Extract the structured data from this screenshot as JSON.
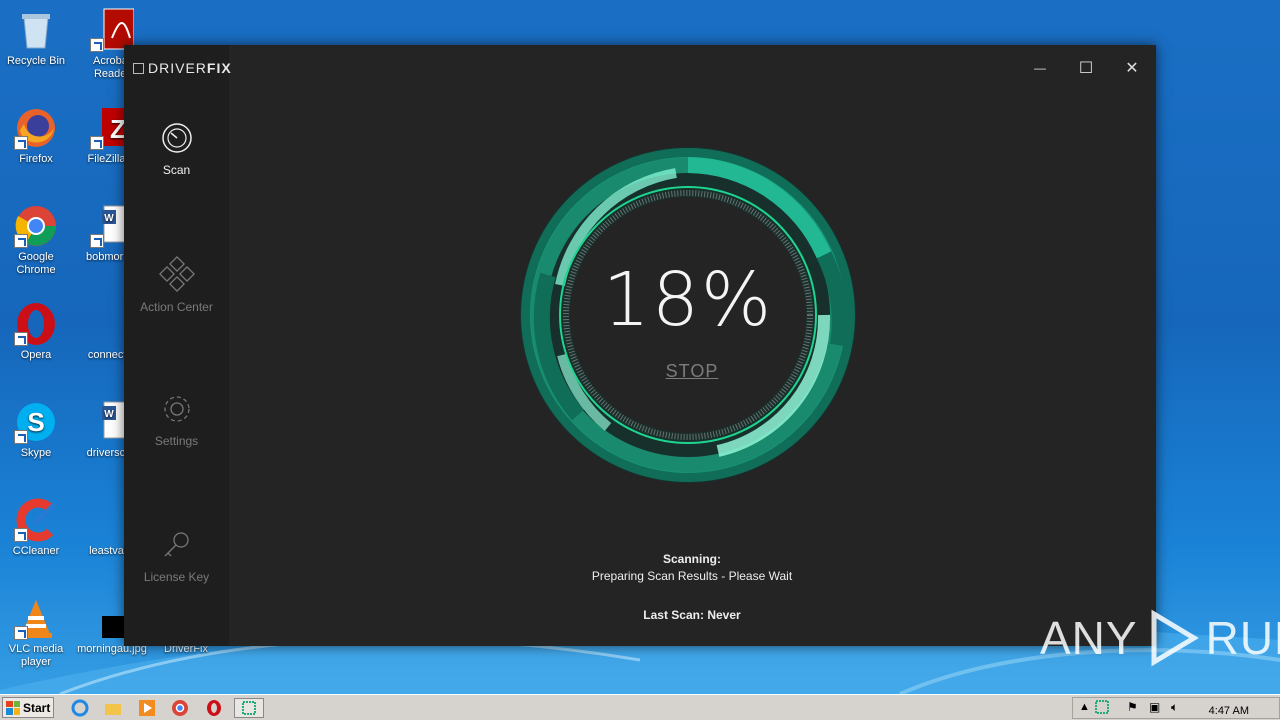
{
  "desktop": {
    "icons": [
      {
        "label": "Recycle Bin"
      },
      {
        "label": "Acrobat\nReader"
      },
      {
        "label": "Firefox"
      },
      {
        "label": "FileZilla C"
      },
      {
        "label": "Google\nChrome"
      },
      {
        "label": "bobmornin"
      },
      {
        "label": "Opera"
      },
      {
        "label": "connectar"
      },
      {
        "label": "Skype"
      },
      {
        "label": "driverscho"
      },
      {
        "label": "CCleaner"
      },
      {
        "label": "leastvalid"
      },
      {
        "label": "VLC media\nplayer"
      },
      {
        "label": "morningau.jpg"
      },
      {
        "label": "DriverFix"
      }
    ]
  },
  "app": {
    "brand_light": "DRIVER",
    "brand_bold": "FIX",
    "nav": [
      {
        "label": "Scan",
        "icon": "gauge-icon",
        "active": true
      },
      {
        "label": "Action Center",
        "icon": "diamond-grid-icon",
        "active": false
      },
      {
        "label": "Settings",
        "icon": "gear-icon",
        "active": false
      },
      {
        "label": "License Key",
        "icon": "key-icon",
        "active": false
      }
    ],
    "window_controls": {
      "minimize": "—",
      "maximize": "☐",
      "close": "✕"
    },
    "scan": {
      "percent": "18%",
      "progress": 0.18,
      "stop_label": "STOP",
      "status_title": "Scanning:",
      "status_detail": "Preparing Scan Results - Please Wait",
      "last_scan": "Last Scan: Never"
    },
    "colors": {
      "accent": "#27c39a",
      "accent_dark": "#0c5c4c",
      "bg": "#252425",
      "sidebar": "#1f1e1f"
    }
  },
  "taskbar": {
    "start_label": "Start",
    "clock": "4:47 AM"
  },
  "watermark": {
    "left": "ANY",
    "right": "RUN"
  }
}
